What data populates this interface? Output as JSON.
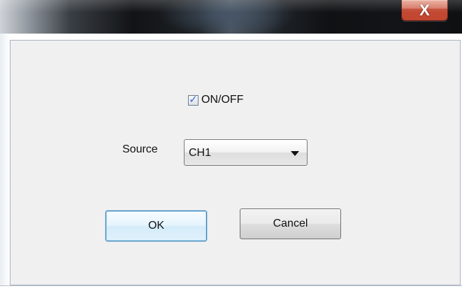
{
  "window": {
    "close_symbol": "X"
  },
  "dialog": {
    "checkbox_label": "ON/OFF",
    "checkbox_checked": true,
    "source_label": "Source",
    "source_value": "CH1",
    "ok_label": "OK",
    "cancel_label": "Cancel"
  },
  "icons": {
    "close": "close-icon",
    "checkmark": "checkmark-icon",
    "dropdown": "chevron-down-icon"
  },
  "colors": {
    "close_button": "#c2462f",
    "focus_border": "#3c7fb1",
    "checkmark": "#3f67d8"
  }
}
